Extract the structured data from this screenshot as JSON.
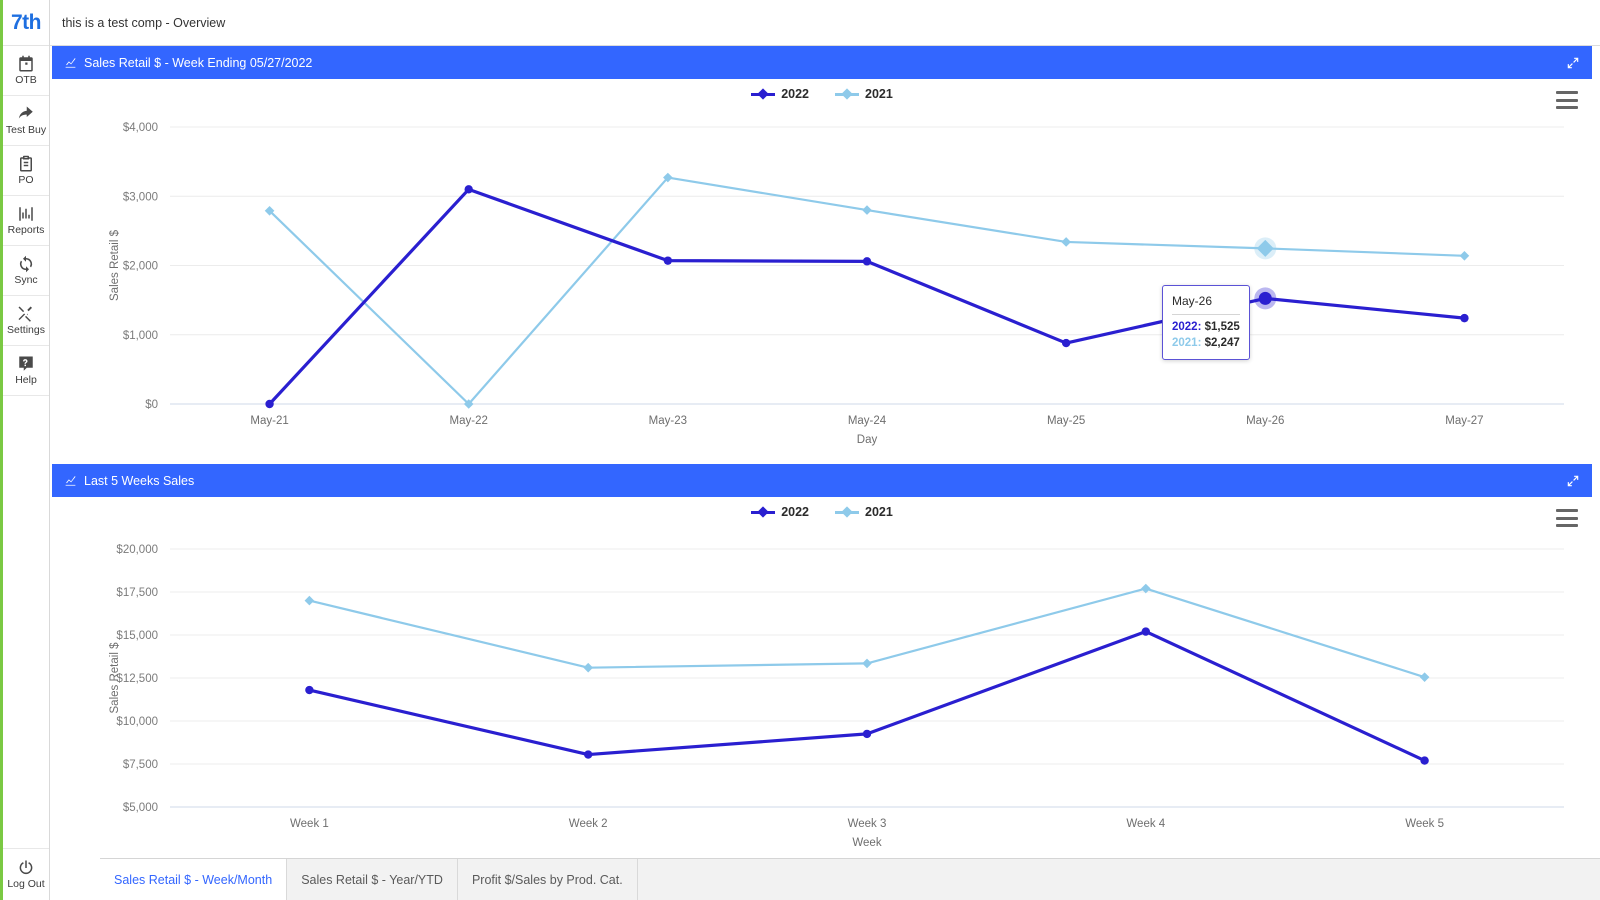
{
  "brand": {
    "logo_text": "7th",
    "accent_green": "#7ac943",
    "accent_blue": "#3366ff"
  },
  "topbar": {
    "title": "this is a test comp - Overview"
  },
  "sidebar": {
    "items": [
      {
        "label": "OTB",
        "icon": "calendar-icon"
      },
      {
        "label": "Test Buy",
        "icon": "arrow-share-icon"
      },
      {
        "label": "PO",
        "icon": "clipboard-icon"
      },
      {
        "label": "Reports",
        "icon": "bar-chart-icon"
      },
      {
        "label": "Sync",
        "icon": "sync-icon"
      },
      {
        "label": "Settings",
        "icon": "tools-icon"
      },
      {
        "label": "Help",
        "icon": "help-icon"
      }
    ],
    "logout": {
      "label": "Log Out",
      "icon": "power-icon"
    }
  },
  "panels": [
    {
      "title": "Sales Retail $ - Week Ending 05/27/2022",
      "icon": "line-chart-icon",
      "expand_icon": "expand-arrows-icon",
      "menu_icon": "hamburger-menu-icon"
    },
    {
      "title": "Last 5 Weeks Sales",
      "icon": "line-chart-icon",
      "expand_icon": "expand-arrows-icon",
      "menu_icon": "hamburger-menu-icon"
    }
  ],
  "tooltip": {
    "title": "May-26",
    "rows": [
      {
        "key": "2022:",
        "value": "$1,525",
        "color": "#2a1fd0"
      },
      {
        "key": "2021:",
        "value": "$2,247",
        "color": "#8ecaea"
      }
    ]
  },
  "tabs": [
    {
      "label": "Sales Retail $ - Week/Month",
      "active": true
    },
    {
      "label": "Sales Retail $ - Year/YTD",
      "active": false
    },
    {
      "label": "Profit $/Sales by Prod. Cat.",
      "active": false
    }
  ],
  "chart_data": [
    {
      "type": "line",
      "title": "Sales Retail $ - Week Ending 05/27/2022",
      "xlabel": "Day",
      "ylabel": "Sales Retail $",
      "categories": [
        "May-21",
        "May-22",
        "May-23",
        "May-24",
        "May-25",
        "May-26",
        "May-27"
      ],
      "ytick_labels": [
        "$0",
        "$1,000",
        "$2,000",
        "$3,000",
        "$4,000"
      ],
      "yticks": [
        0,
        1000,
        2000,
        3000,
        4000
      ],
      "ylim": [
        0,
        4000
      ],
      "grid": true,
      "legend_position": "top-center",
      "series": [
        {
          "name": "2022",
          "color": "#2a1fd0",
          "values": [
            0,
            3100,
            2070,
            2060,
            880,
            1525,
            1240
          ]
        },
        {
          "name": "2021",
          "color": "#8ecaea",
          "values": [
            2790,
            0,
            3270,
            2800,
            2340,
            2247,
            2140
          ]
        }
      ],
      "highlight": {
        "category": "May-26",
        "index": 5
      }
    },
    {
      "type": "line",
      "title": "Last 5 Weeks Sales",
      "xlabel": "Week",
      "ylabel": "Sales Retail $",
      "categories": [
        "Week 1",
        "Week 2",
        "Week 3",
        "Week 4",
        "Week 5"
      ],
      "ytick_labels": [
        "$5,000",
        "$7,500",
        "$10,000",
        "$12,500",
        "$15,000",
        "$17,500",
        "$20,000"
      ],
      "yticks": [
        5000,
        7500,
        10000,
        12500,
        15000,
        17500,
        20000
      ],
      "ylim": [
        5000,
        20000
      ],
      "grid": true,
      "legend_position": "top-center",
      "series": [
        {
          "name": "2022",
          "color": "#2a1fd0",
          "values": [
            11800,
            8050,
            9250,
            15200,
            7700
          ]
        },
        {
          "name": "2021",
          "color": "#8ecaea",
          "values": [
            17000,
            13100,
            13350,
            17700,
            12550
          ]
        }
      ]
    }
  ]
}
